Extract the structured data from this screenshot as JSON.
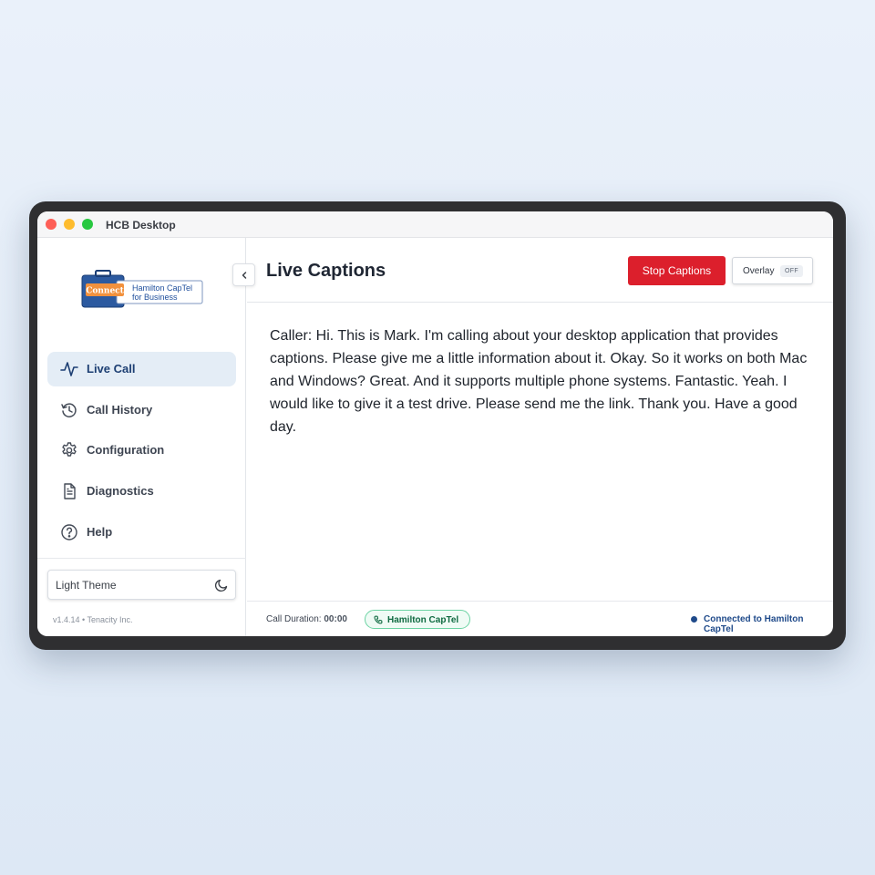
{
  "window": {
    "title": "HCB Desktop"
  },
  "logo": {
    "badge": "Connect",
    "line1": "Hamilton CapTel",
    "line2": "for Business"
  },
  "sidebar": {
    "items": [
      {
        "label": "Live Call",
        "icon": "activity-icon",
        "active": true
      },
      {
        "label": "Call History",
        "icon": "history-icon",
        "active": false
      },
      {
        "label": "Configuration",
        "icon": "gear-icon",
        "active": false
      },
      {
        "label": "Diagnostics",
        "icon": "document-icon",
        "active": false
      },
      {
        "label": "Help",
        "icon": "help-circle-icon",
        "active": false
      }
    ],
    "theme_label": "Light Theme",
    "version": "v1.4.14 • Tenacity Inc."
  },
  "header": {
    "title": "Live Captions",
    "stop_label": "Stop Captions",
    "overlay_label": "Overlay",
    "overlay_state": "OFF"
  },
  "captions": {
    "text": "Caller: Hi. This is Mark. I'm calling about your desktop application that provides captions. Please give me a little information about it. Okay. So it works on both Mac and Windows? Great. And it supports multiple phone systems. Fantastic. Yeah. I would like to give it a test drive. Please send me the link. Thank you. Have a good day."
  },
  "footer": {
    "duration_label": "Call Duration:",
    "duration_value": "00:00",
    "provider": "Hamilton CapTel",
    "status": "Connected to Hamilton CapTel"
  },
  "colors": {
    "accent": "#1d3f73",
    "stop": "#dc1f2c",
    "provider_green": "#0f6a41",
    "status_blue": "#1f4a8a"
  }
}
